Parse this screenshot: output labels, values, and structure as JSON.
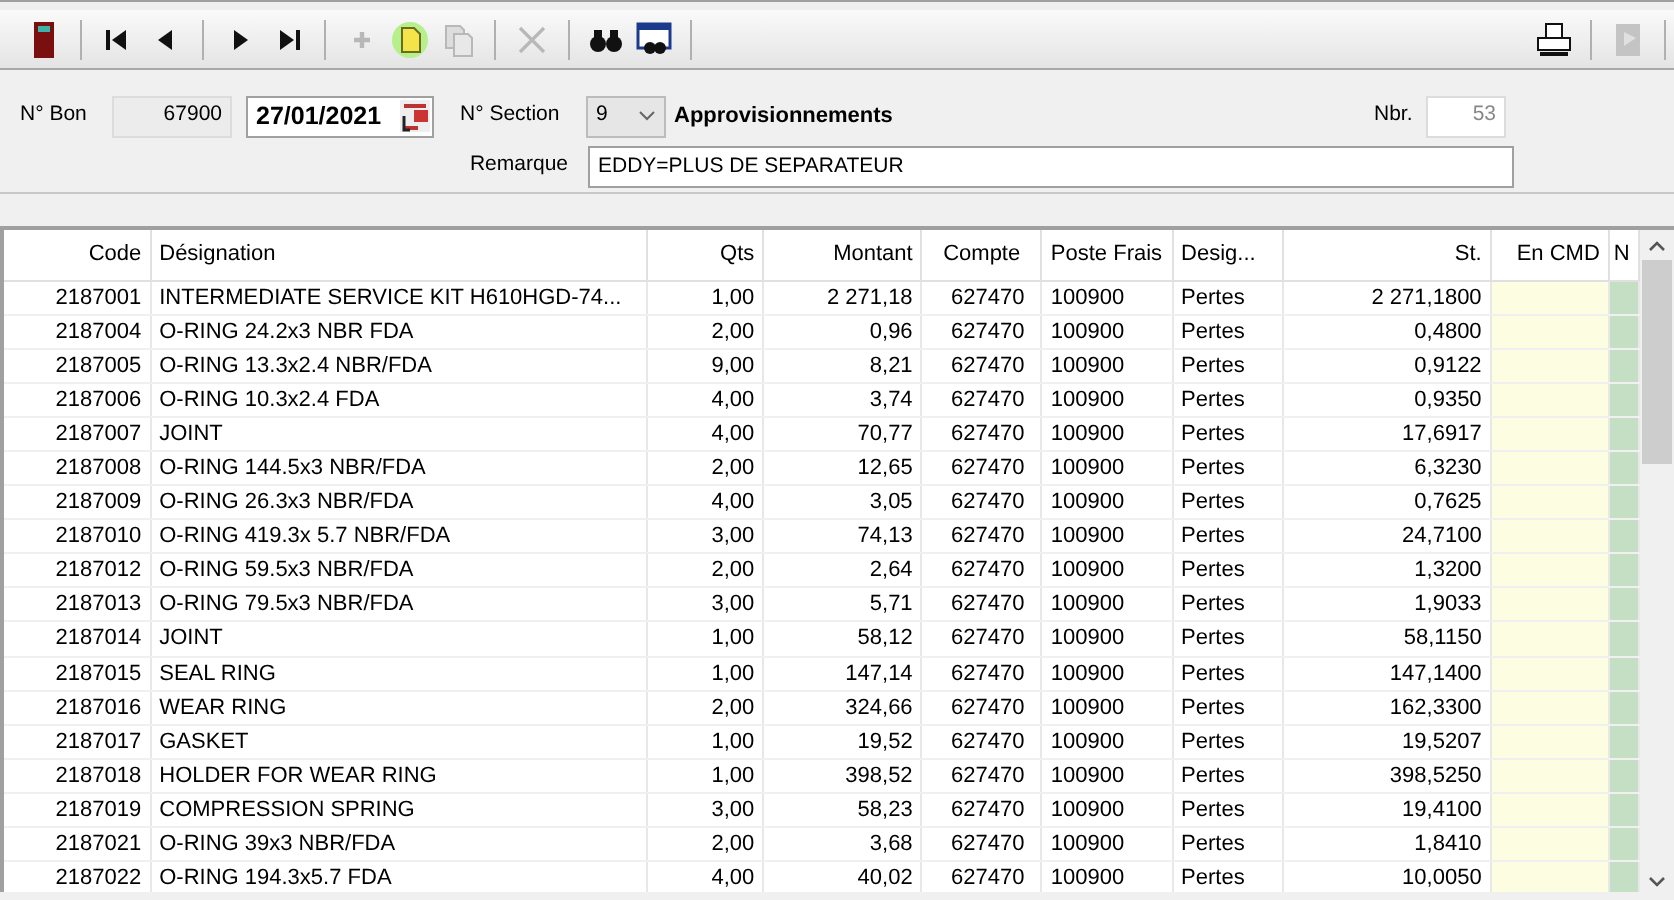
{
  "toolbar": {
    "left": [
      [
        {
          "kind": "exit",
          "disabled": false
        }
      ],
      [
        {
          "kind": "first",
          "disabled": false
        },
        {
          "kind": "prev",
          "disabled": false
        }
      ],
      [
        {
          "kind": "next",
          "disabled": false
        },
        {
          "kind": "last",
          "disabled": false
        }
      ],
      [
        {
          "kind": "add",
          "disabled": true
        },
        {
          "kind": "new",
          "disabled": false
        },
        {
          "kind": "copy",
          "disabled": true
        }
      ],
      [
        {
          "kind": "delete",
          "disabled": true
        }
      ],
      [
        {
          "kind": "search",
          "disabled": false
        },
        {
          "kind": "search-list",
          "disabled": false
        }
      ]
    ],
    "right": [
      [
        {
          "kind": "print",
          "disabled": false
        }
      ],
      [
        {
          "kind": "close",
          "disabled": true
        }
      ]
    ]
  },
  "form": {
    "bon_label": "N° Bon",
    "bon": "67900",
    "date": "27/01/2021",
    "section_label": "N° Section",
    "section": "9",
    "section_name": "Approvisionnements",
    "nbr_label": "Nbr.",
    "nbr": "53",
    "remarque_label": "Remarque",
    "remarque": "EDDY=PLUS DE SEPARATEUR"
  },
  "table": {
    "columns": [
      "Code",
      "Désignation",
      "Qts",
      "Montant",
      "Compte",
      "Poste Frais",
      "Desig...",
      "St.",
      "En CMD",
      "N"
    ],
    "rows": [
      [
        "2187001",
        "INTERMEDIATE SERVICE KIT H610HGD-74...",
        "1,00",
        "2 271,18",
        "627470",
        "100900",
        "Pertes",
        "2 271,1800"
      ],
      [
        "2187004",
        "O-RING 24.2x3 NBR FDA",
        "2,00",
        "0,96",
        "627470",
        "100900",
        "Pertes",
        "0,4800"
      ],
      [
        "2187005",
        "O-RING 13.3x2.4 NBR/FDA",
        "9,00",
        "8,21",
        "627470",
        "100900",
        "Pertes",
        "0,9122"
      ],
      [
        "2187006",
        "O-RING 10.3x2.4 FDA",
        "4,00",
        "3,74",
        "627470",
        "100900",
        "Pertes",
        "0,9350"
      ],
      [
        "2187007",
        "JOINT",
        "4,00",
        "70,77",
        "627470",
        "100900",
        "Pertes",
        "17,6917"
      ],
      [
        "2187008",
        "O-RING 144.5x3 NBR/FDA",
        "2,00",
        "12,65",
        "627470",
        "100900",
        "Pertes",
        "6,3230"
      ],
      [
        "2187009",
        "O-RING 26.3x3 NBR/FDA",
        "4,00",
        "3,05",
        "627470",
        "100900",
        "Pertes",
        "0,7625"
      ],
      [
        "2187010",
        "O-RING 419.3x 5.7 NBR/FDA",
        "3,00",
        "74,13",
        "627470",
        "100900",
        "Pertes",
        "24,7100"
      ],
      [
        "2187012",
        "O-RING 59.5x3 NBR/FDA",
        "2,00",
        "2,64",
        "627470",
        "100900",
        "Pertes",
        "1,3200"
      ],
      [
        "2187013",
        "O-RING 79.5x3 NBR/FDA",
        "3,00",
        "5,71",
        "627470",
        "100900",
        "Pertes",
        "1,9033"
      ],
      [
        "2187014",
        "JOINT",
        "1,00",
        "58,12",
        "627470",
        "100900",
        "Pertes",
        "58,1150"
      ],
      [
        "2187015",
        "SEAL RING",
        "1,00",
        "147,14",
        "627470",
        "100900",
        "Pertes",
        "147,1400"
      ],
      [
        "2187016",
        "WEAR RING",
        "2,00",
        "324,66",
        "627470",
        "100900",
        "Pertes",
        "162,3300"
      ],
      [
        "2187017",
        "GASKET",
        "1,00",
        "19,52",
        "627470",
        "100900",
        "Pertes",
        "19,5207"
      ],
      [
        "2187018",
        "HOLDER FOR WEAR RING",
        "1,00",
        "398,52",
        "627470",
        "100900",
        "Pertes",
        "398,5250"
      ],
      [
        "2187019",
        "COMPRESSION SPRING",
        "3,00",
        "58,23",
        "627470",
        "100900",
        "Pertes",
        "19,4100"
      ],
      [
        "2187021",
        "O-RING 39x3 NBR/FDA",
        "2,00",
        "3,68",
        "627470",
        "100900",
        "Pertes",
        "1,8410"
      ],
      [
        "2187022",
        "O-RING 194.3x5.7 FDA",
        "4,00",
        "40,02",
        "627470",
        "100900",
        "Pertes",
        "10,0050"
      ]
    ]
  }
}
